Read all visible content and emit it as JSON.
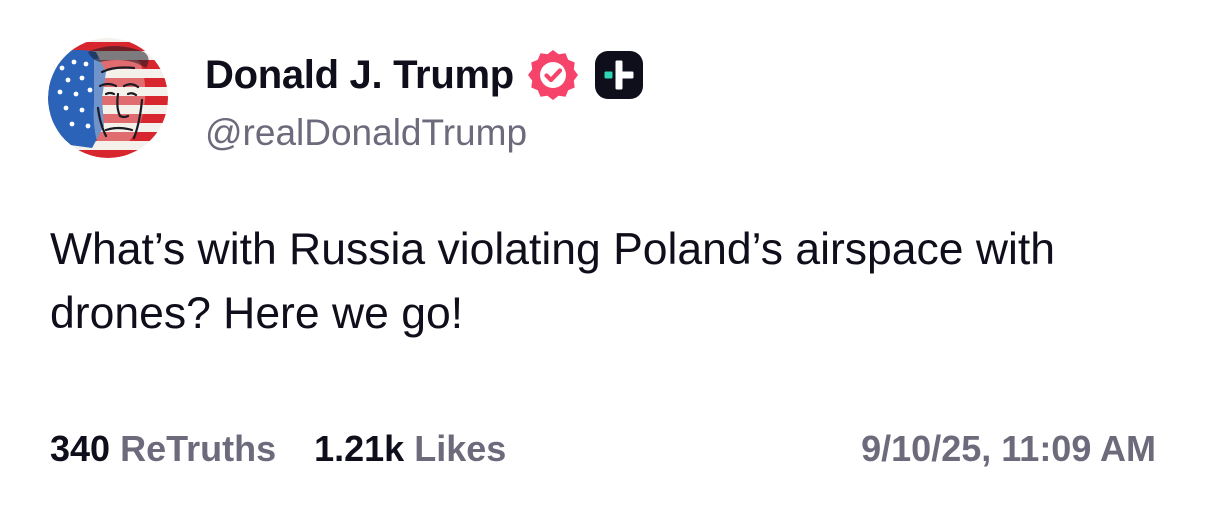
{
  "post": {
    "author": {
      "display_name": "Donald J. Trump",
      "handle": "@realDonaldTrump",
      "avatar_icon": "flag-portrait-avatar",
      "verified_icon": "verified-badge-icon",
      "verified_color": "#f5436a",
      "plus_icon": "truth-plus-icon",
      "plus_accent": "#2fd7b5"
    },
    "text": "What’s with Russia violating Poland’s airspace with drones? Here we go!",
    "stats": {
      "retruths_count": "340",
      "retruths_label": "ReTruths",
      "likes_count": "1.21k",
      "likes_label": "Likes"
    },
    "timestamp": "9/10/25, 11:09 AM"
  },
  "colors": {
    "text_primary": "#0f0e1b",
    "text_secondary": "#6c6a7b",
    "background": "#ffffff"
  }
}
